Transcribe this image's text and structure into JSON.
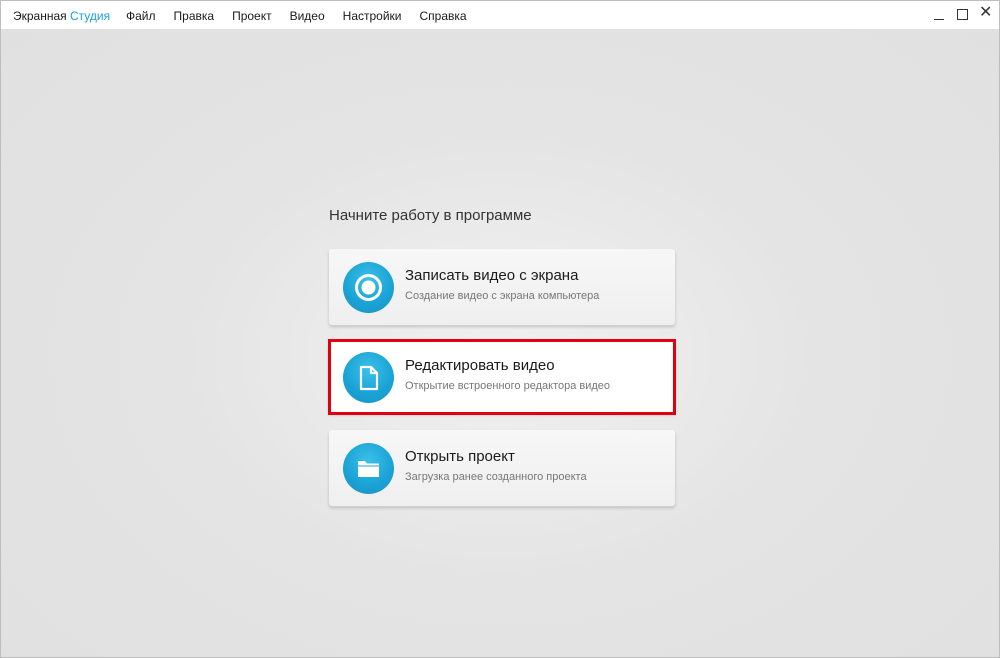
{
  "app": {
    "title_part1": "Экранная ",
    "title_part2": "Студия"
  },
  "menu": {
    "items": [
      {
        "label": "Файл"
      },
      {
        "label": "Правка"
      },
      {
        "label": "Проект"
      },
      {
        "label": "Видео"
      },
      {
        "label": "Настройки"
      },
      {
        "label": "Справка"
      }
    ]
  },
  "window_controls": {
    "minimize_icon": "minimize-icon",
    "maximize_icon": "maximize-icon",
    "close_icon": "close-icon",
    "close_glyph": "✕"
  },
  "start": {
    "prompt": "Начните работу в программе",
    "actions": [
      {
        "title": "Записать видео с экрана",
        "subtitle": "Создание видео с экрана компьютера",
        "icon": "record-icon"
      },
      {
        "title": "Редактировать видео",
        "subtitle": "Открытие встроенного редактора видео",
        "icon": "document-icon",
        "highlighted": true
      },
      {
        "title": "Открыть проект",
        "subtitle": "Загрузка ранее созданного проекта",
        "icon": "folder-icon"
      }
    ]
  },
  "colors": {
    "accent": "#1aa3d6",
    "highlight_border": "#e0000f",
    "background": "#e4e4e4"
  }
}
